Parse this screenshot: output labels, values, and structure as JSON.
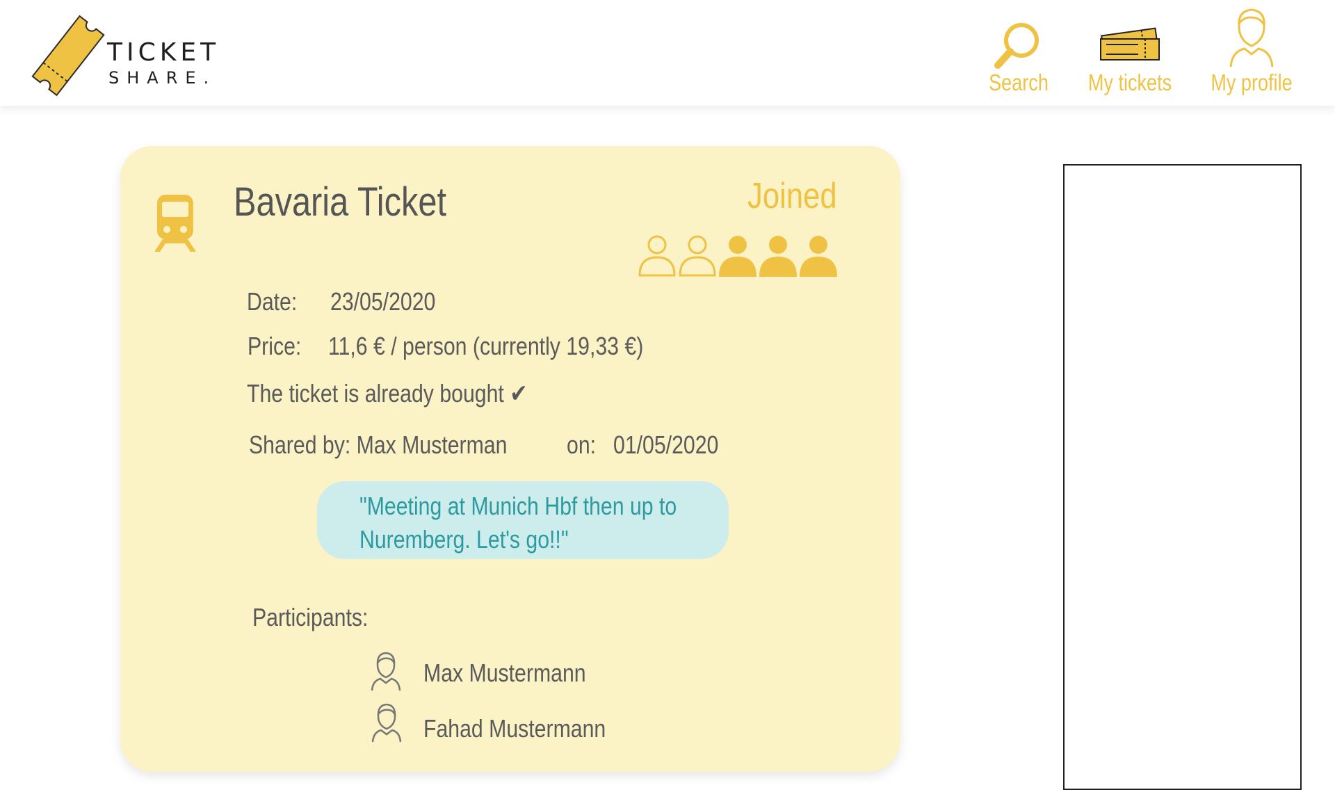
{
  "header": {
    "logo": {
      "word1": "TICKET",
      "word2": "SHARE."
    },
    "nav": [
      {
        "label": "Search",
        "icon": "search-icon"
      },
      {
        "label": "My tickets",
        "icon": "tickets-icon"
      },
      {
        "label": "My profile",
        "icon": "profile-icon"
      }
    ]
  },
  "ticket": {
    "icon": "train-icon",
    "title": "Bavaria Ticket",
    "status": "Joined",
    "capacity": {
      "total": 5,
      "filled": 3
    },
    "date_label": "Date:",
    "date_value": "23/05/2020",
    "price_label": "Price:",
    "price_value": "11,6 € / person (currently 19,33 €)",
    "bought_text": "The ticket is already bought ✔",
    "shared_by": "Shared by: Max Musterman",
    "on_label": "on:",
    "on_value": "01/05/2020",
    "quote": "\"Meeting at Munich Hbf  then up to Nuremberg. Let's go!!\"",
    "participants_label": "Participants:",
    "participants": [
      {
        "name": "Max Mustermann",
        "icon": "avatar-icon"
      },
      {
        "name": "Fahad Mustermann",
        "icon": "avatar-icon"
      }
    ]
  },
  "colors": {
    "accent": "#f0c244",
    "card_bg": "#fbf2c5",
    "bubble_bg": "#cdecec",
    "bubble_text": "#2c9aa0",
    "text": "#5a5a5a"
  }
}
